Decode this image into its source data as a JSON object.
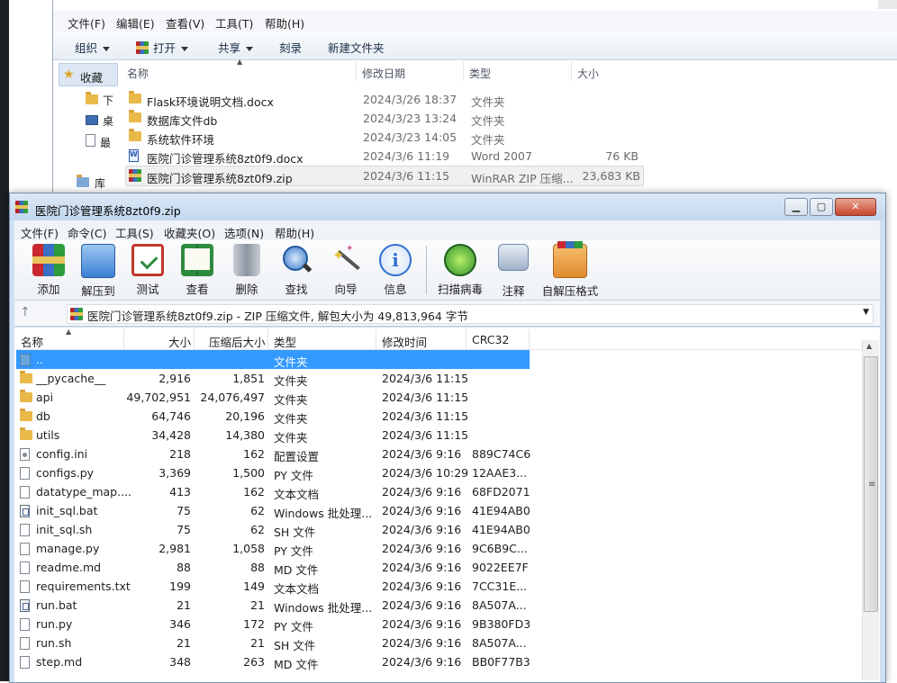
{
  "explorer": {
    "menu": [
      "文件(F)",
      "编辑(E)",
      "查看(V)",
      "工具(T)",
      "帮助(H)"
    ],
    "toolbar": {
      "organize": "组织",
      "open": "打开",
      "share": "共享",
      "burn": "刻录",
      "new_folder": "新建文件夹"
    },
    "nav": {
      "favorites": "收藏",
      "library": "库",
      "item1": "下",
      "item2": "桌",
      "item3": "最"
    },
    "columns": {
      "name": "名称",
      "modified": "修改日期",
      "type": "类型",
      "size": "大小"
    },
    "files": [
      {
        "icon": "folder-icon",
        "name": "Flask环境说明文档.docx",
        "modified": "2024/3/26 18:37",
        "type": "文件夹",
        "size": ""
      },
      {
        "icon": "folder-icon",
        "name": "数据库文件db",
        "modified": "2024/3/23 13:24",
        "type": "文件夹",
        "size": ""
      },
      {
        "icon": "folder-icon",
        "name": "系统软件环境",
        "modified": "2024/3/23 14:05",
        "type": "文件夹",
        "size": ""
      },
      {
        "icon": "word-doc-icon",
        "name": "医院门诊管理系统8zt0f9.docx",
        "modified": "2024/3/6 11:19",
        "type": "Word 2007",
        "size": "76 KB"
      },
      {
        "icon": "winrar-archive-icon",
        "name": "医院门诊管理系统8zt0f9.zip",
        "modified": "2024/3/6 11:15",
        "type": "WinRAR ZIP 压缩...",
        "size": "23,683 KB"
      }
    ]
  },
  "winrar": {
    "title": "医院门诊管理系统8zt0f9.zip",
    "menu": [
      "文件(F)",
      "命令(C)",
      "工具(S)",
      "收藏夹(O)",
      "选项(N)",
      "帮助(H)"
    ],
    "tools": [
      {
        "name": "add",
        "label": "添加",
        "icon": "add-archive-icon",
        "color": "#d9342b"
      },
      {
        "name": "extract",
        "label": "解压到",
        "icon": "extract-folder-icon",
        "color": "#3b7fd4"
      },
      {
        "name": "test",
        "label": "测试",
        "icon": "test-clipboard-icon",
        "color": "#c0392b"
      },
      {
        "name": "view",
        "label": "查看",
        "icon": "view-book-icon",
        "color": "#2e8b3e"
      },
      {
        "name": "delete",
        "label": "删除",
        "icon": "trash-icon",
        "color": "#8b95a1"
      },
      {
        "name": "find",
        "label": "查找",
        "icon": "magnifier-icon",
        "color": "#3a78c9"
      },
      {
        "name": "wizard",
        "label": "向导",
        "icon": "wizard-wand-icon",
        "color": "#c7a23a"
      },
      {
        "name": "info",
        "label": "信息",
        "icon": "info-icon",
        "color": "#2f6fd0"
      },
      {
        "name": "virus",
        "label": "扫描病毒",
        "icon": "virus-bug-icon",
        "color": "#3fa53a"
      },
      {
        "name": "comment",
        "label": "注释",
        "icon": "comment-icon",
        "color": "#6f87a8"
      },
      {
        "name": "sfx",
        "label": "自解压格式",
        "icon": "sfx-box-icon",
        "color": "#e08a2e"
      }
    ],
    "address": "医院门诊管理系统8zt0f9.zip - ZIP 压缩文件, 解包大小为 49,813,964 字节",
    "columns": {
      "name": "名称",
      "size": "大小",
      "packed": "压缩后大小",
      "type": "类型",
      "modified": "修改时间",
      "crc": "CRC32"
    },
    "rows": [
      {
        "icon": "up-folder-icon",
        "name": "..",
        "size": "",
        "packed": "",
        "type": "文件夹",
        "modified": "",
        "crc": "",
        "selected": true
      },
      {
        "icon": "folder-icon",
        "name": "__pycache__",
        "size": "2,916",
        "packed": "1,851",
        "type": "文件夹",
        "modified": "2024/3/6 11:15",
        "crc": ""
      },
      {
        "icon": "folder-icon",
        "name": "api",
        "size": "49,702,951",
        "packed": "24,076,497",
        "type": "文件夹",
        "modified": "2024/3/6 11:15",
        "crc": ""
      },
      {
        "icon": "folder-icon",
        "name": "db",
        "size": "64,746",
        "packed": "20,196",
        "type": "文件夹",
        "modified": "2024/3/6 11:15",
        "crc": ""
      },
      {
        "icon": "folder-icon",
        "name": "utils",
        "size": "34,428",
        "packed": "14,380",
        "type": "文件夹",
        "modified": "2024/3/6 11:15",
        "crc": ""
      },
      {
        "icon": "ini-file-icon",
        "name": "config.ini",
        "size": "218",
        "packed": "162",
        "type": "配置设置",
        "modified": "2024/3/6 9:16",
        "crc": "889C74C6"
      },
      {
        "icon": "file-icon",
        "name": "configs.py",
        "size": "3,369",
        "packed": "1,500",
        "type": "PY 文件",
        "modified": "2024/3/6 10:29",
        "crc": "12AAE3..."
      },
      {
        "icon": "file-icon",
        "name": "datatype_map....",
        "size": "413",
        "packed": "162",
        "type": "文本文档",
        "modified": "2024/3/6 9:16",
        "crc": "68FD2071"
      },
      {
        "icon": "bat-file-icon",
        "name": "init_sql.bat",
        "size": "75",
        "packed": "62",
        "type": "Windows 批处理...",
        "modified": "2024/3/6 9:16",
        "crc": "41E94AB0"
      },
      {
        "icon": "file-icon",
        "name": "init_sql.sh",
        "size": "75",
        "packed": "62",
        "type": "SH 文件",
        "modified": "2024/3/6 9:16",
        "crc": "41E94AB0"
      },
      {
        "icon": "file-icon",
        "name": "manage.py",
        "size": "2,981",
        "packed": "1,058",
        "type": "PY 文件",
        "modified": "2024/3/6 9:16",
        "crc": "9C6B9C..."
      },
      {
        "icon": "file-icon",
        "name": "readme.md",
        "size": "88",
        "packed": "88",
        "type": "MD 文件",
        "modified": "2024/3/6 9:16",
        "crc": "9022EE7F"
      },
      {
        "icon": "file-icon",
        "name": "requirements.txt",
        "size": "199",
        "packed": "149",
        "type": "文本文档",
        "modified": "2024/3/6 9:16",
        "crc": "7CC31E..."
      },
      {
        "icon": "bat-file-icon",
        "name": "run.bat",
        "size": "21",
        "packed": "21",
        "type": "Windows 批处理...",
        "modified": "2024/3/6 9:16",
        "crc": "8A507A..."
      },
      {
        "icon": "file-icon",
        "name": "run.py",
        "size": "346",
        "packed": "172",
        "type": "PY 文件",
        "modified": "2024/3/6 9:16",
        "crc": "9B380FD3"
      },
      {
        "icon": "file-icon",
        "name": "run.sh",
        "size": "21",
        "packed": "21",
        "type": "SH 文件",
        "modified": "2024/3/6 9:16",
        "crc": "8A507A..."
      },
      {
        "icon": "file-icon",
        "name": "step.md",
        "size": "348",
        "packed": "263",
        "type": "MD 文件",
        "modified": "2024/3/6 9:16",
        "crc": "BB0F77B3"
      }
    ]
  }
}
